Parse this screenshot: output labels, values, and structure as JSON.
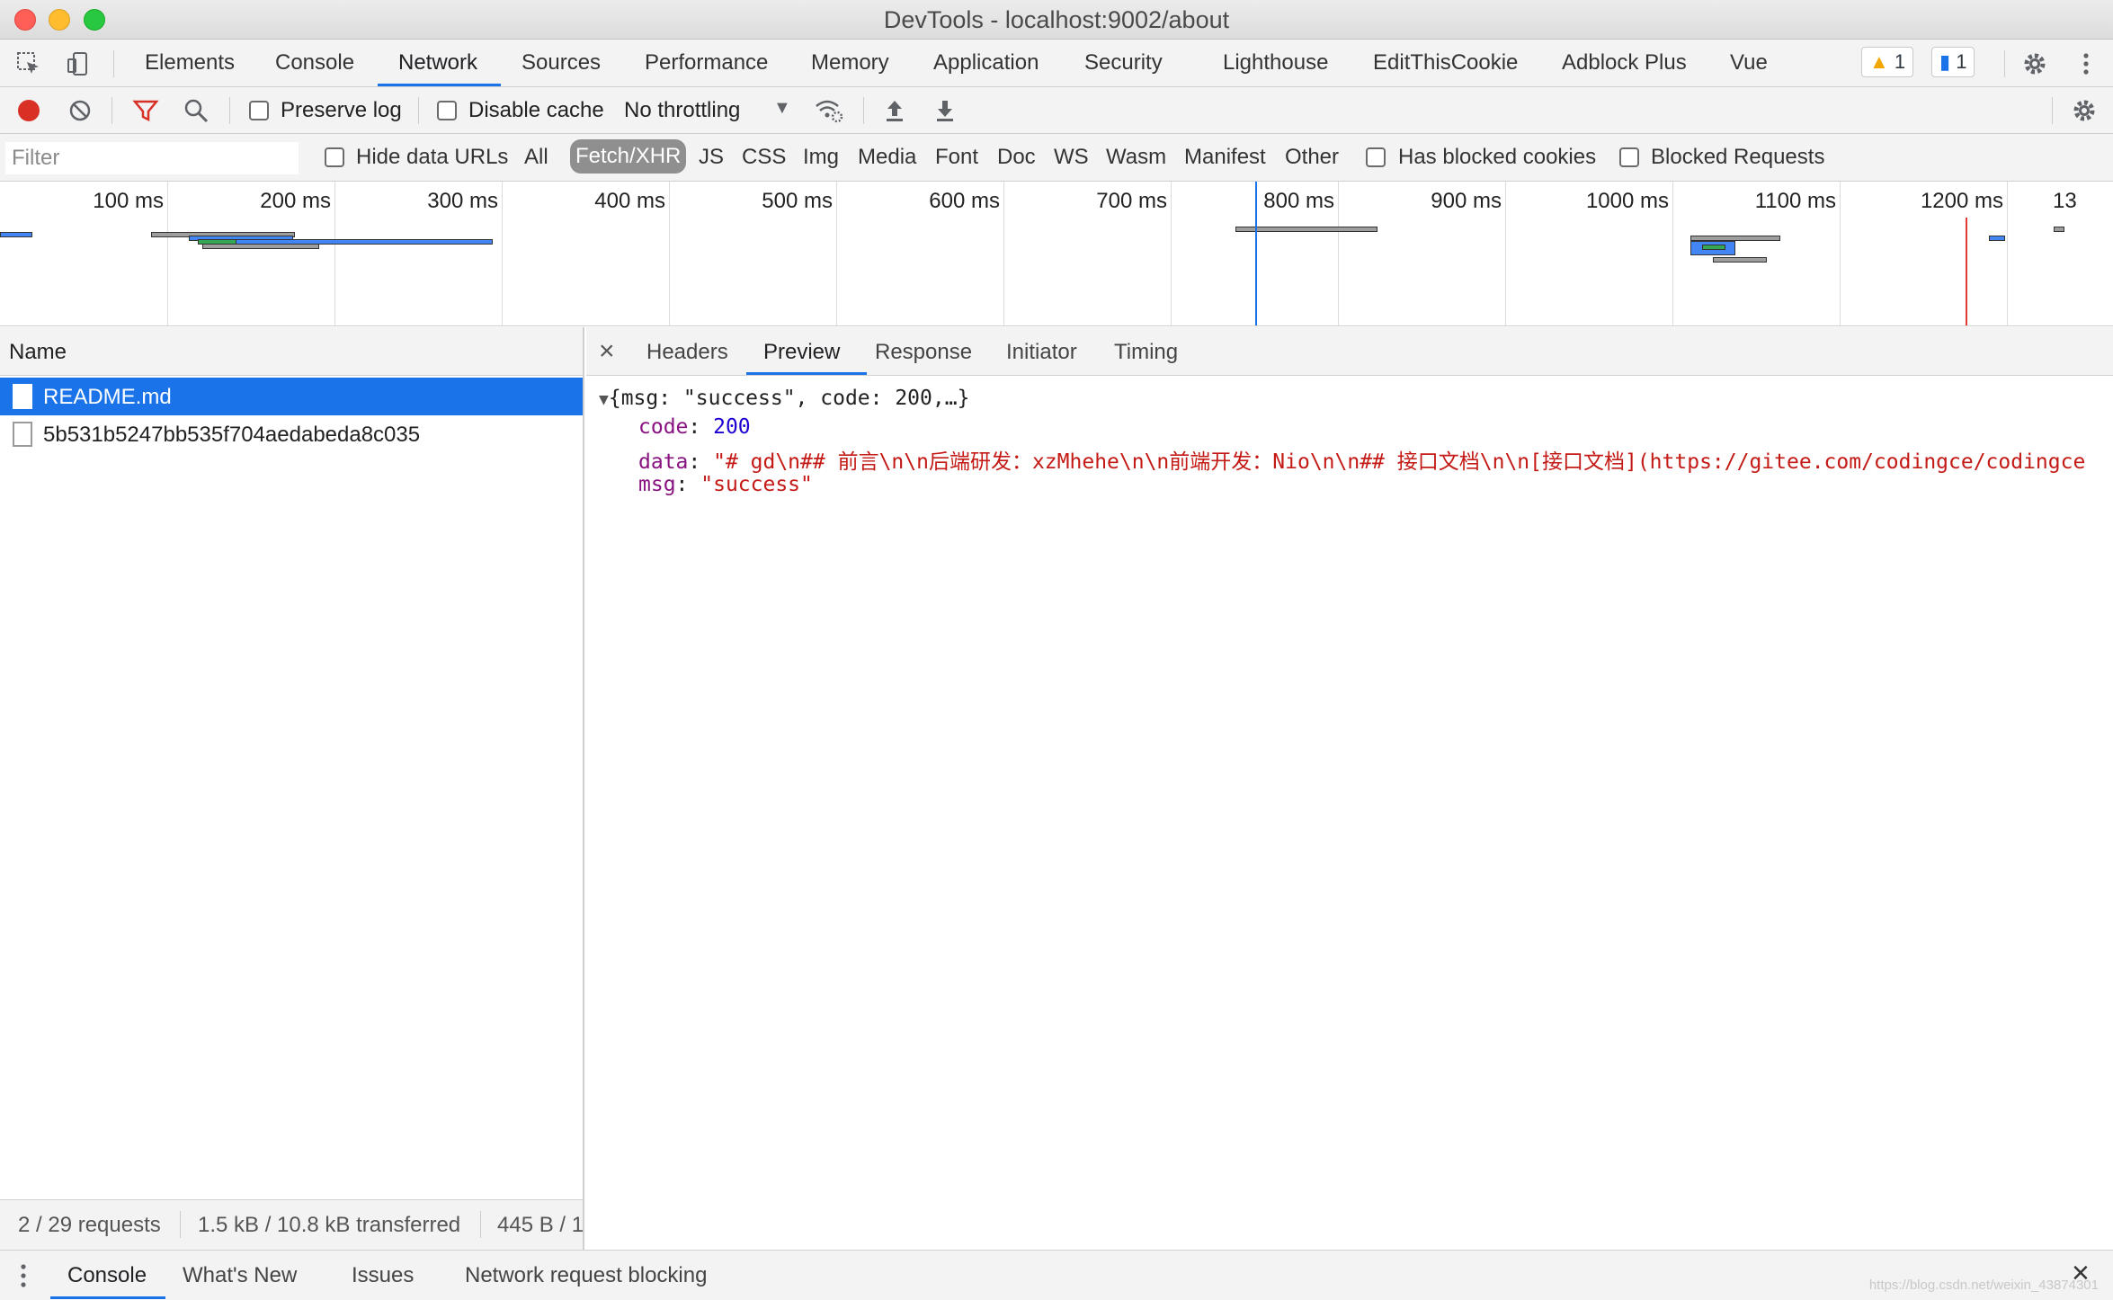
{
  "window": {
    "title": "DevTools - localhost:9002/about"
  },
  "main_tabs": [
    "Elements",
    "Console",
    "Network",
    "Sources",
    "Performance",
    "Memory",
    "Application",
    "Security",
    "Lighthouse",
    "EditThisCookie",
    "Adblock Plus",
    "Vue"
  ],
  "active_main_tab": "Network",
  "badges": {
    "warnings": "1",
    "messages": "1"
  },
  "network_toolbar": {
    "preserve_log": "Preserve log",
    "disable_cache": "Disable cache",
    "throttling": "No throttling"
  },
  "filter_bar": {
    "placeholder": "Filter",
    "hide_data_urls": "Hide data URLs",
    "types": [
      "All",
      "Fetch/XHR",
      "JS",
      "CSS",
      "Img",
      "Media",
      "Font",
      "Doc",
      "WS",
      "Wasm",
      "Manifest",
      "Other"
    ],
    "selected_type": "Fetch/XHR",
    "has_blocked_cookies": "Has blocked cookies",
    "blocked_requests": "Blocked Requests"
  },
  "overview": {
    "ticks": [
      "100 ms",
      "200 ms",
      "300 ms",
      "400 ms",
      "500 ms",
      "600 ms",
      "700 ms",
      "800 ms",
      "900 ms",
      "1000 ms",
      "1100 ms",
      "1200 ms",
      "13"
    ]
  },
  "requests": {
    "column": "Name",
    "rows": [
      {
        "name": "README.md",
        "selected": true
      },
      {
        "name": "5b531b5247bb535f704aedabeda8c035",
        "selected": false
      }
    ],
    "summary": {
      "count": "2 / 29 requests",
      "transferred": "1.5 kB / 10.8 kB transferred",
      "resources": "445 B / 1"
    }
  },
  "detail": {
    "tabs": [
      "Headers",
      "Preview",
      "Response",
      "Initiator",
      "Timing"
    ],
    "active_tab": "Preview",
    "preview": {
      "summary": "{msg: \"success\", code: 200,…}",
      "code_key": "code",
      "code_value": "200",
      "data_key": "data",
      "data_value": "\"# gd\\n## 前言\\n\\n后端研发：xzMhehe\\n\\n前端开发：Nio\\n\\n## 接口文档\\n\\n[接口文档](https://gitee.com/codingce/codingce",
      "msg_key": "msg",
      "msg_value": "\"success\""
    }
  },
  "drawer": {
    "tabs": [
      "Console",
      "What's New",
      "Issues",
      "Network request blocking"
    ],
    "active_tab": "Console",
    "watermark": "https://blog.csdn.net/weixin_43874301"
  },
  "colors": {
    "accent": "#1a73e8",
    "record": "#d93025",
    "filter_icon": "#d93025"
  }
}
